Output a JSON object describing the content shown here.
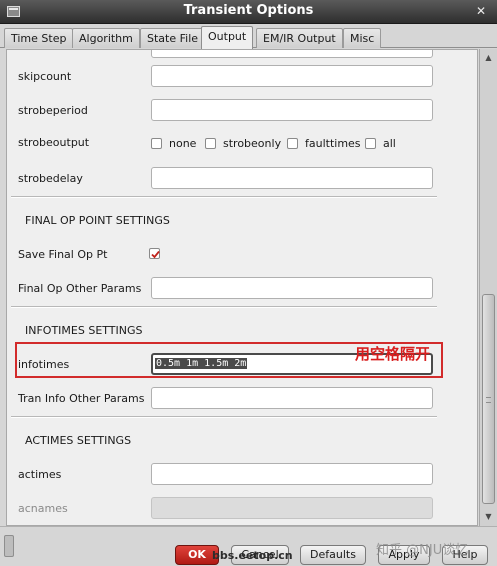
{
  "window": {
    "title": "Transient Options",
    "close_glyph": "✕"
  },
  "tabs": [
    {
      "label": "Time Step"
    },
    {
      "label": "Algorithm"
    },
    {
      "label": "State File"
    },
    {
      "label": "Output"
    },
    {
      "label": "EM/IR Output"
    },
    {
      "label": "Misc"
    }
  ],
  "fields": {
    "skipcount": {
      "label": "skipcount",
      "value": ""
    },
    "strobeperiod": {
      "label": "strobeperiod",
      "value": ""
    },
    "strobeoutput": {
      "label": "strobeoutput",
      "options": [
        "none",
        "strobeonly",
        "faulttimes",
        "all"
      ]
    },
    "strobedelay": {
      "label": "strobedelay",
      "value": ""
    }
  },
  "final_op": {
    "section": "FINAL OP POINT SETTINGS",
    "save_label": "Save Final Op Pt",
    "save_checked": true,
    "other_label": "Final Op Other Params",
    "other_value": ""
  },
  "infotimes": {
    "section": "INFOTIMES SETTINGS",
    "label": "infotimes",
    "value": "0.5m 1m 1.5m 2m",
    "tran_label": "Tran Info Other Params",
    "tran_value": ""
  },
  "annotation": "用空格隔开",
  "actimes": {
    "section": "ACTIMES SETTINGS",
    "label": "actimes",
    "value": "",
    "acnames_label": "acnames",
    "acnames_value": ""
  },
  "buttons": {
    "ok": "OK",
    "cancel": "Cancel",
    "defaults": "Defaults",
    "apply": "Apply",
    "help": "Help"
  },
  "watermarks": [
    "知乎 @NJU谈忆",
    "bbs.eetop.cn"
  ],
  "colors": {
    "titlebar": "#2e2e2e",
    "annotation_red": "#d81e1e",
    "ok_button": "#c0221b"
  }
}
